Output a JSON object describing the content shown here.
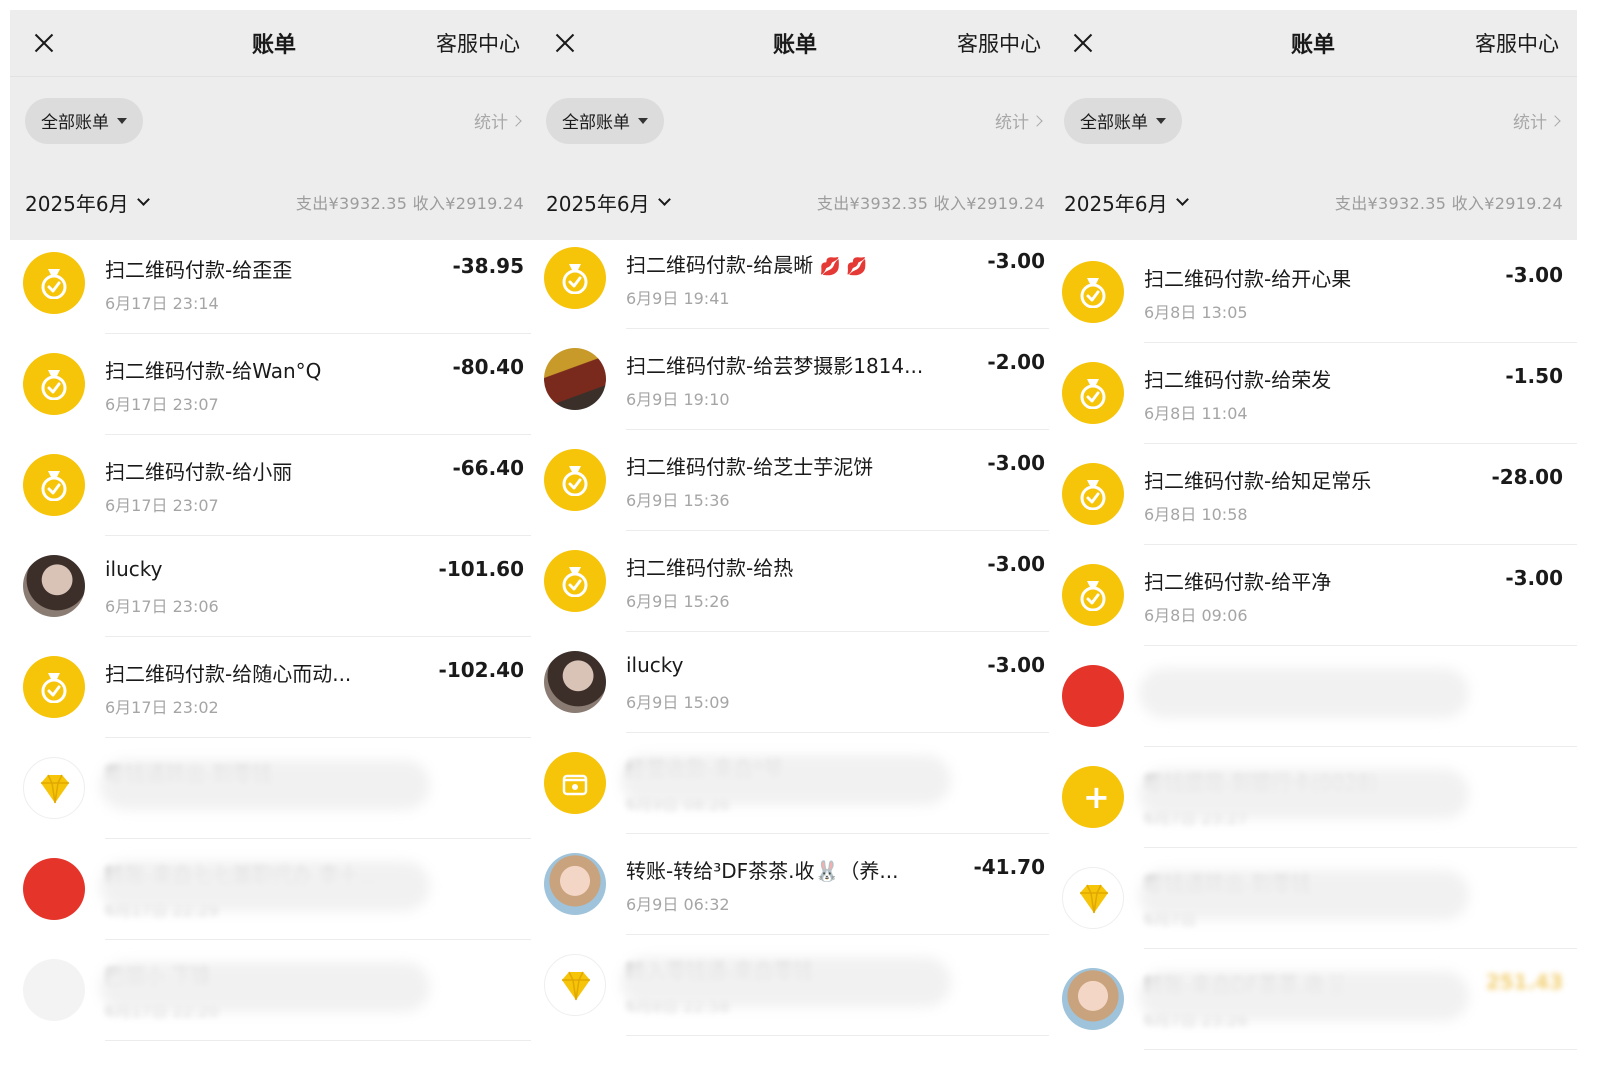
{
  "header": {
    "close_label": "✕",
    "title": "账单",
    "service": "客服中心",
    "filter_label": "全部账单",
    "stats_label": "统计",
    "month_label": "2025年6月",
    "summary": "支出¥3932.35  收入¥2919.24"
  },
  "colors": {
    "accent_yellow": "#f6c409",
    "income": "#e8a800",
    "header_bg": "#ededed"
  },
  "panels": [
    {
      "rows": [
        {
          "name": "扫二维码付款-给歪歪",
          "time": "6月17日 23:14",
          "amount": "-38.95",
          "avatar": "money-bag-icon"
        },
        {
          "name": "扫二维码付款-给Wan°Q",
          "time": "6月17日 23:07",
          "amount": "-80.40",
          "avatar": "money-bag-icon"
        },
        {
          "name": "扫二维码付款-给小丽",
          "time": "6月17日 23:07",
          "amount": "-66.40",
          "avatar": "money-bag-icon"
        },
        {
          "name": "ilucky",
          "time": "6月17日 23:06",
          "amount": "-101.60",
          "avatar": "user-photo"
        },
        {
          "name": "扫二维码付款-给随心而动...",
          "time": "6月17日 23:02",
          "amount": "-102.40",
          "avatar": "money-bag-icon"
        },
        {
          "name": "零钱通转出-到零钱",
          "time": "",
          "amount": "",
          "avatar": "diamond-icon"
        },
        {
          "name": "转账-来自七七兼职代办 李十...",
          "time": "6月17日 22:29",
          "amount": "",
          "avatar": "red-avatar"
        },
        {
          "name": "巴丽小 下锋",
          "time": "6月17日 22:20",
          "amount": "",
          "avatar": "white-avatar"
        }
      ]
    },
    {
      "rows": [
        {
          "name": "扫二维码付款-给晨晰",
          "time": "6月9日 19:41",
          "amount": "-3.00",
          "avatar": "money-bag-icon",
          "emoji": "💋 💋"
        },
        {
          "name": "扫二维码付款-给芸梦摄影1814...",
          "time": "6月9日 19:10",
          "amount": "-2.00",
          "avatar": "shop-photo"
        },
        {
          "name": "扫二维码付款-给芝士芋泥饼",
          "time": "6月9日 15:36",
          "amount": "-3.00",
          "avatar": "money-bag-icon"
        },
        {
          "name": "扫二维码付款-给热",
          "time": "6月9日 15:26",
          "amount": "-3.00",
          "avatar": "money-bag-icon"
        },
        {
          "name": "ilucky",
          "time": "6月9日 15:09",
          "amount": "-3.00",
          "avatar": "user-photo"
        },
        {
          "name": "经营收款-来自*爷",
          "time": "6月9日 08:26",
          "amount": "",
          "avatar": "shop-icon"
        },
        {
          "name": "转账-转给³DF茶茶.收🐰（养...",
          "time": "6月9日 06:32",
          "amount": "-41.70",
          "avatar": "cartoon-avatar"
        },
        {
          "name": "转入零钱通-来自零钱",
          "time": "6月8日 22:58",
          "amount": "",
          "avatar": "diamond-icon"
        }
      ]
    },
    {
      "rows": [
        {
          "name": "扫二维码付款-给开心果",
          "time": "6月8日 13:05",
          "amount": "-3.00",
          "avatar": "money-bag-icon"
        },
        {
          "name": "扫二维码付款-给荣发",
          "time": "6月8日 11:04",
          "amount": "-1.50",
          "avatar": "money-bag-icon"
        },
        {
          "name": "扫二维码付款-给知足常乐",
          "time": "6月8日 10:58",
          "amount": "-28.00",
          "avatar": "money-bag-icon"
        },
        {
          "name": "扫二维码付款-给平净",
          "time": "6月8日 09:06",
          "amount": "-3.00",
          "avatar": "money-bag-icon"
        },
        {
          "name": "",
          "time": "",
          "amount": "",
          "avatar": "red-avatar"
        },
        {
          "name": "零钱提现-到银行卡(0028)",
          "time": "6月7日 23:27",
          "amount": "",
          "avatar": "yellow-plus"
        },
        {
          "name": "零钱通转出-到零钱",
          "time": "6月7日",
          "amount": "",
          "avatar": "diamond-icon"
        },
        {
          "name": "转账-来自DF茶茶.收🐰",
          "time": "6月7日 23:26",
          "amount": "251.43",
          "avatar": "cartoon-avatar"
        }
      ]
    }
  ]
}
